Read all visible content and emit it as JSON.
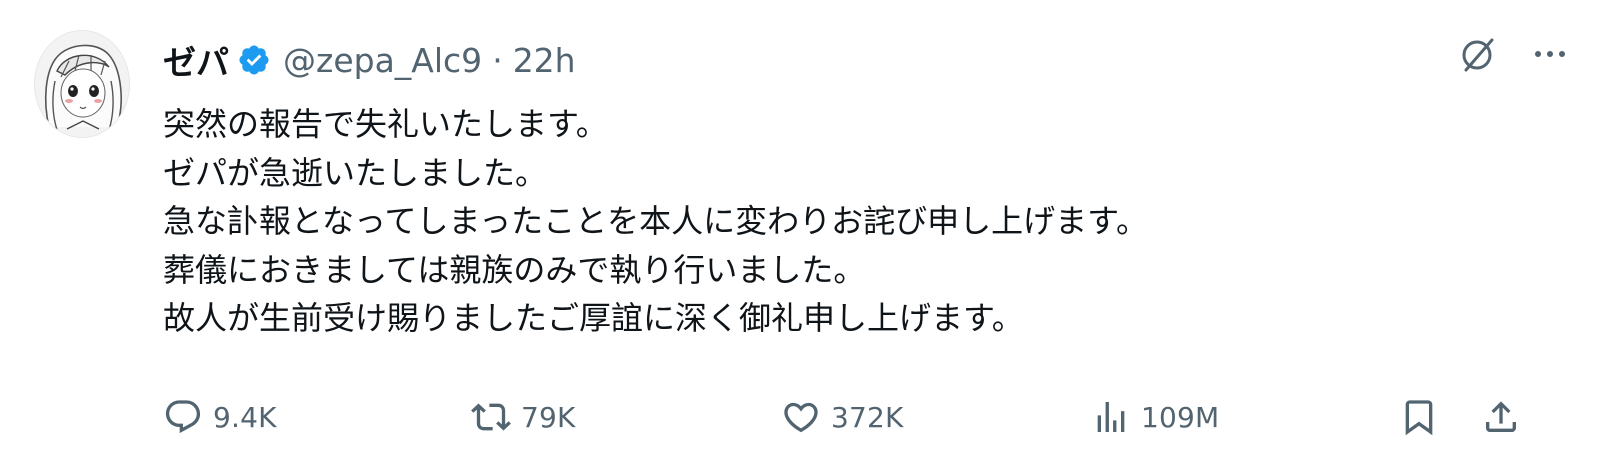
{
  "author": {
    "display_name": "ゼパ",
    "handle": "@zepa_Alc9",
    "separator": "·",
    "timestamp": "22h",
    "verified": true,
    "avatar": "anime-girl-drawing-avatar"
  },
  "top_actions": [
    {
      "icon": "grok-icon"
    },
    {
      "icon": "more-icon"
    }
  ],
  "body": {
    "lines": [
      "突然の報告で失礼いたします。",
      "ゼパが急逝いたしました。",
      "急な訃報となってしまったことを本人に変わりお詫び申し上げます。",
      "葬儀におきましては親族のみで執り行いました。",
      "故人が生前受け賜りましたご厚誼に深く御礼申し上げます。"
    ]
  },
  "actions": {
    "reply": {
      "icon": "reply-icon",
      "count": "9.4K"
    },
    "retweet": {
      "icon": "retweet-icon",
      "count": "79K"
    },
    "like": {
      "icon": "like-icon",
      "count": "372K"
    },
    "views": {
      "icon": "views-icon",
      "count": "109M"
    },
    "bookmark": {
      "icon": "bookmark-icon"
    },
    "share": {
      "icon": "share-icon"
    }
  },
  "colors": {
    "text": "#0f1419",
    "secondary": "#536471",
    "verified_blue": "#1d9bf0"
  }
}
